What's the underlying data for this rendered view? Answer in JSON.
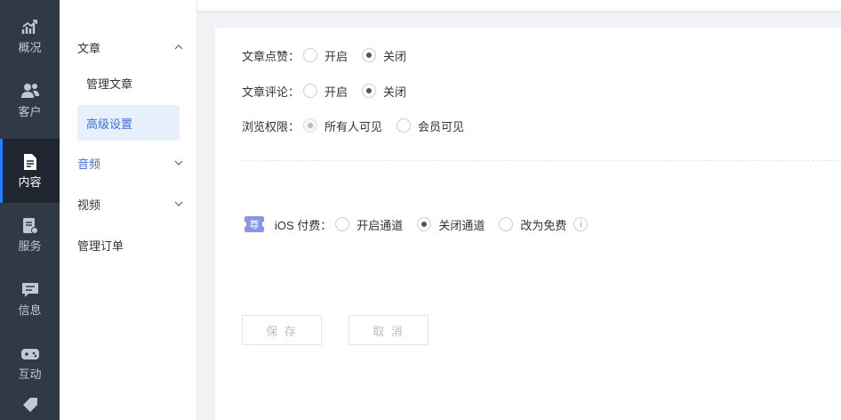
{
  "rail": {
    "items": [
      {
        "label": "概况",
        "icon": "chart-icon"
      },
      {
        "label": "客户",
        "icon": "users-icon"
      },
      {
        "label": "内容",
        "icon": "document-icon",
        "active": true
      },
      {
        "label": "服务",
        "icon": "service-icon"
      },
      {
        "label": "信息",
        "icon": "message-icon"
      },
      {
        "label": "互动",
        "icon": "gamepad-icon"
      }
    ]
  },
  "subnav": {
    "article": "文章",
    "manage_article": "管理文章",
    "advanced_settings": "高级设置",
    "audio": "音频",
    "video": "视频",
    "manage_orders": "管理订单"
  },
  "settings": {
    "like": {
      "label": "文章点赞：",
      "on": "开启",
      "off": "关闭",
      "selected": "off"
    },
    "comment": {
      "label": "文章评论：",
      "on": "开启",
      "off": "关闭",
      "selected": "off"
    },
    "permission": {
      "label": "浏览权限：",
      "all": "所有人可见",
      "member": "会员可见",
      "selected": "all"
    },
    "ios": {
      "badge": "尊",
      "label": "iOS 付费：",
      "open": "开启通道",
      "close": "关闭通道",
      "free": "改为免费",
      "selected": "close",
      "info": "i"
    }
  },
  "buttons": {
    "save": "保 存",
    "cancel": "取 消"
  },
  "colors": {
    "accent": "#3d6fdb",
    "rail_bg": "#2f3a46",
    "badge": "#8a94e6"
  }
}
